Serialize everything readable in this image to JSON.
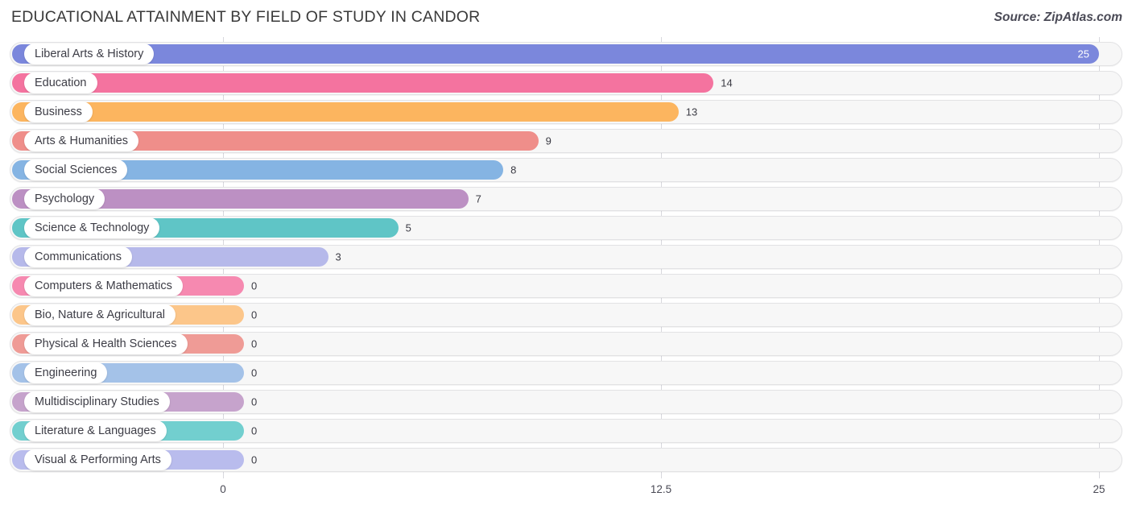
{
  "header": {
    "title": "EDUCATIONAL ATTAINMENT BY FIELD OF STUDY IN CANDOR",
    "source": "Source: ZipAtlas.com"
  },
  "chart_data": {
    "type": "bar",
    "orientation": "horizontal",
    "title": "EDUCATIONAL ATTAINMENT BY FIELD OF STUDY IN CANDOR",
    "xlabel": "",
    "ylabel": "",
    "xlim": [
      0,
      25
    ],
    "xticks": [
      "0",
      "12.5",
      "25"
    ],
    "xtick_values": [
      0,
      12.5,
      25
    ],
    "grid": true,
    "legend": false,
    "categories": [
      "Liberal Arts & History",
      "Education",
      "Business",
      "Arts & Humanities",
      "Social Sciences",
      "Psychology",
      "Science & Technology",
      "Communications",
      "Computers & Mathematics",
      "Bio, Nature & Agricultural",
      "Physical & Health Sciences",
      "Engineering",
      "Multidisciplinary Studies",
      "Literature & Languages",
      "Visual & Performing Arts"
    ],
    "values": [
      25,
      14,
      13,
      9,
      8,
      7,
      5,
      3,
      0,
      0,
      0,
      0,
      0,
      0,
      0
    ],
    "value_labels": [
      "25",
      "14",
      "13",
      "9",
      "8",
      "7",
      "5",
      "3",
      "0",
      "0",
      "0",
      "0",
      "0",
      "0",
      "0"
    ],
    "colors": [
      "#7b87dc",
      "#f4739f",
      "#fcb55f",
      "#ef8e8a",
      "#85b4e3",
      "#bc90c3",
      "#5fc5c6",
      "#b6b9ea",
      "#f689b0",
      "#fcc68a",
      "#ef9b96",
      "#a4c2e8",
      "#c6a3cc",
      "#72cfcf",
      "#b9bced"
    ]
  }
}
